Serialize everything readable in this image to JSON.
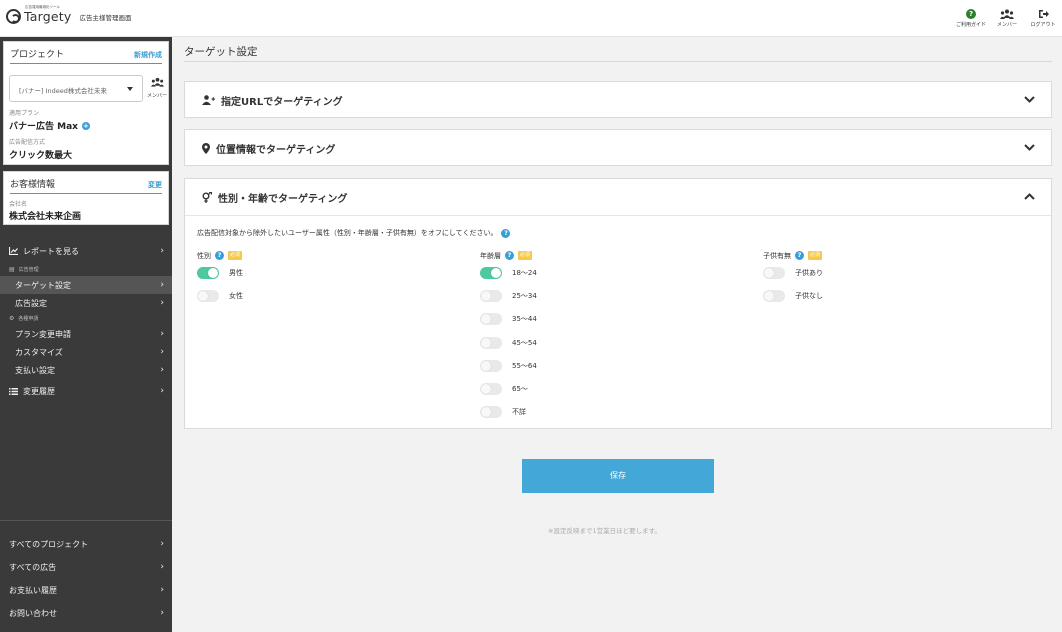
{
  "header": {
    "logo_tagline": "広告運用最適化ツール",
    "logo_name": "Targety",
    "app_name": "広告主様管理画面",
    "actions": [
      {
        "label": "ご利用ガイド",
        "icon": "help-icon"
      },
      {
        "label": "メンバー",
        "icon": "members-icon"
      },
      {
        "label": "ログアウト",
        "icon": "logout-icon"
      }
    ]
  },
  "sidebar": {
    "project": {
      "title": "プロジェクト",
      "new_link": "新規作成",
      "selected": "[バナー] Indeed株式会社未来",
      "member_label": "メンバー",
      "plan_label": "適用プラン",
      "plan_value": "バナー広告 Max",
      "delivery_label": "広告配信方式",
      "delivery_value": "クリック数最大"
    },
    "customer": {
      "title": "お客様情報",
      "change_link": "変更",
      "company_label": "会社名",
      "company_value": "株式会社未来企画"
    },
    "nav": {
      "report": "レポートを見る",
      "section_ad": "広告管理",
      "target": "ターゲット設定",
      "ad_settings": "広告設定",
      "section_apply": "各種申請",
      "plan_change": "プラン変更申請",
      "customize": "カスタマイズ",
      "payment_settings": "支払い設定",
      "history": "変更履歴",
      "all_projects": "すべてのプロジェクト",
      "all_ads": "すべての広告",
      "payment_history": "お支払い履歴",
      "contact": "お問い合わせ"
    }
  },
  "main": {
    "title": "ターゲット設定",
    "panels": [
      {
        "title": "指定URLでターゲティング",
        "icon": "user-plus-icon",
        "expanded": false
      },
      {
        "title": "位置情報でターゲティング",
        "icon": "map-pin-icon",
        "expanded": false
      },
      {
        "title": "性別・年齢でターゲティング",
        "icon": "gender-icon",
        "expanded": true
      }
    ],
    "instruction": "広告配信対象から除外したいユーザー属性（性別・年齢層・子供有無）をオフにしてください。",
    "tag_label": "必須",
    "gender": {
      "label": "性別",
      "options": [
        {
          "label": "男性",
          "on": true
        },
        {
          "label": "女性",
          "on": false
        }
      ]
    },
    "age": {
      "label": "年齢層",
      "options": [
        {
          "label": "18〜24",
          "on": true
        },
        {
          "label": "25〜34",
          "on": false
        },
        {
          "label": "35〜44",
          "on": false
        },
        {
          "label": "45〜54",
          "on": false
        },
        {
          "label": "55〜64",
          "on": false
        },
        {
          "label": "65〜",
          "on": false
        },
        {
          "label": "不詳",
          "on": false
        }
      ]
    },
    "children": {
      "label": "子供有無",
      "options": [
        {
          "label": "子供あり",
          "on": false
        },
        {
          "label": "子供なし",
          "on": false
        }
      ]
    },
    "save_label": "保存",
    "note": "※設定反映まで1営業日ほど要します。"
  },
  "colors": {
    "accent": "#43a8d8",
    "toggle_on": "#4cc9a0",
    "sidebar_bg": "#3a3a3a"
  }
}
